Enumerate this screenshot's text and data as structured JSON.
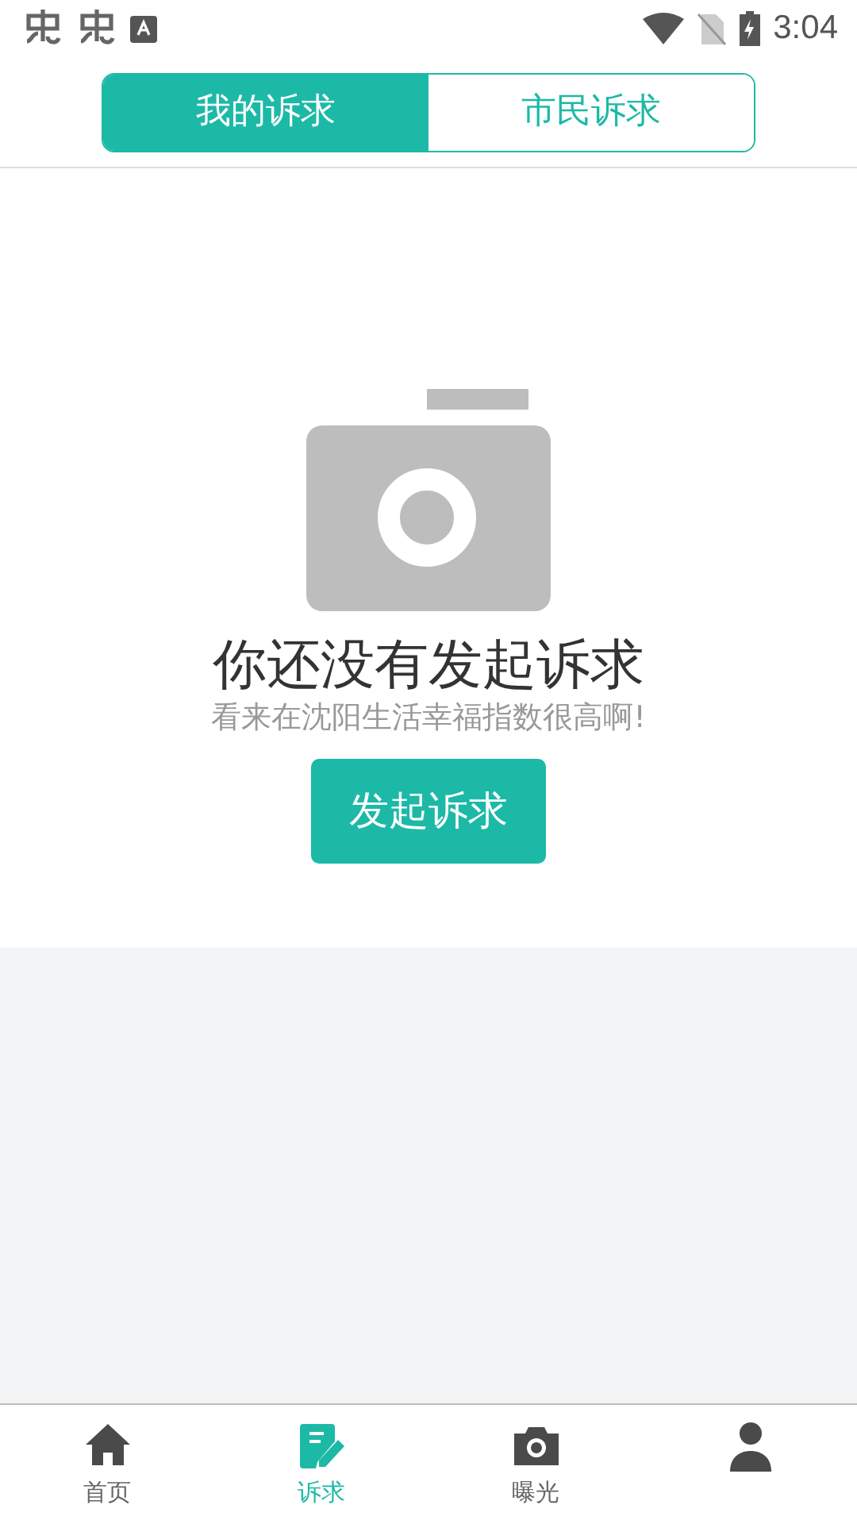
{
  "status_bar": {
    "time": "3:04"
  },
  "tabs": [
    {
      "label": "我的诉求",
      "selected": true
    },
    {
      "label": "市民诉求",
      "selected": false
    }
  ],
  "empty_state": {
    "title": "你还没有发起诉求",
    "subtitle": "看来在沈阳生活幸福指数很高啊!",
    "button": "发起诉求"
  },
  "bottom_nav": [
    {
      "kind": "home",
      "label": "首页",
      "selected": false
    },
    {
      "kind": "edit",
      "label": "诉求",
      "selected": true
    },
    {
      "kind": "camera",
      "label": "曝光",
      "selected": false
    },
    {
      "kind": "person",
      "selected": false
    }
  ]
}
